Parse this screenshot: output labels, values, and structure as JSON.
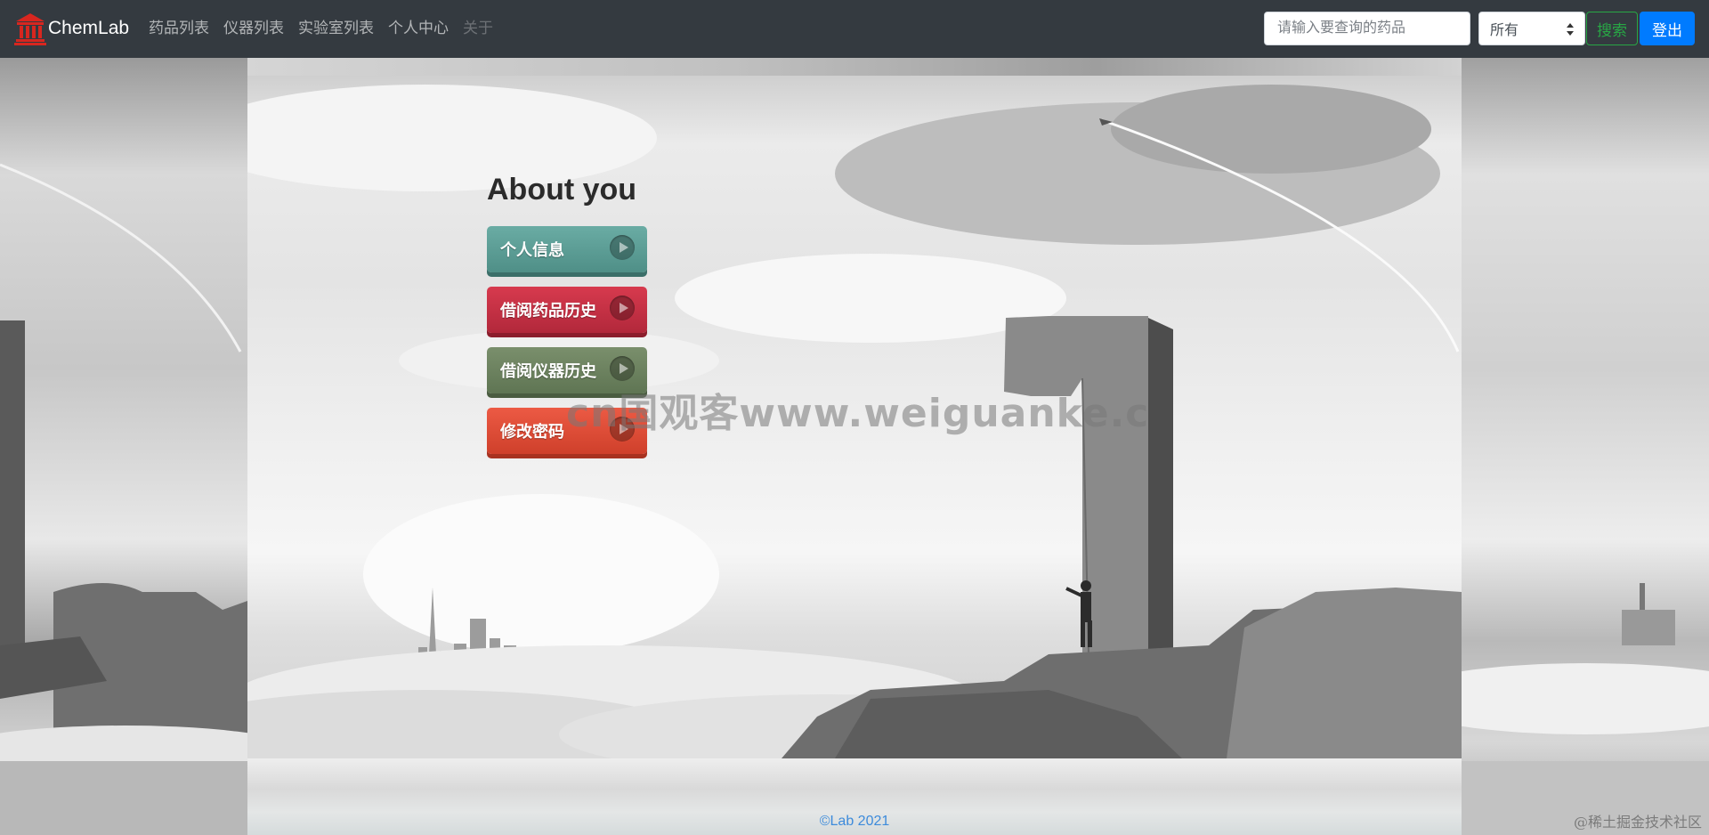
{
  "navbar": {
    "brand": "ChemLab",
    "links": [
      "药品列表",
      "仪器列表",
      "实验室列表",
      "个人中心",
      "关于"
    ],
    "search_placeholder": "请输入要查询的药品",
    "select_value": "所有",
    "search_button": "搜索",
    "logout_button": "登出"
  },
  "about": {
    "title": "About you",
    "buttons": [
      "个人信息",
      "借阅药品历史",
      "借阅仪器历史",
      "修改密码"
    ]
  },
  "watermark": "cn国观客www.weiguanke.c",
  "footer": "©Lab 2021",
  "corner_watermark": "@稀土掘金技术社区",
  "colors": {
    "navbar_bg": "#343a40",
    "search_green": "#28a745",
    "logout_blue": "#007bff",
    "btn_teal": "#5f9e96",
    "btn_red": "#c5303f",
    "btn_green": "#6b8160",
    "btn_orange": "#e04b35",
    "footer_blue": "#3d8bdb"
  }
}
